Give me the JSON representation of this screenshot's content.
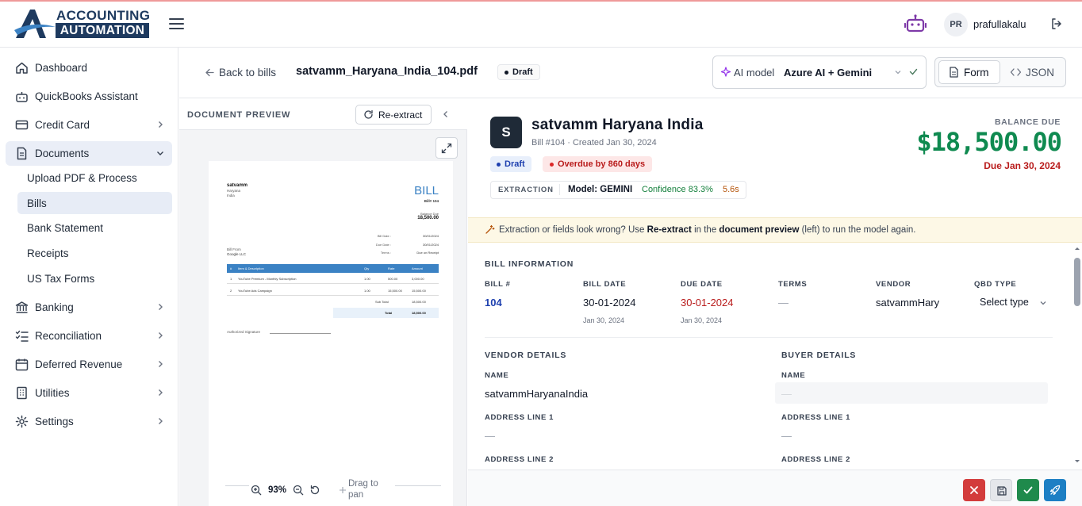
{
  "brand": {
    "line1": "ACCOUNTING",
    "line2": "AUTOMATION"
  },
  "user": {
    "initials": "PR",
    "name": "prafullakalu"
  },
  "sidebar": {
    "items": [
      {
        "label": "Dashboard",
        "icon": "home-icon"
      },
      {
        "label": "QuickBooks Assistant",
        "icon": "robot-icon"
      },
      {
        "label": "Credit Card",
        "icon": "credit-card-icon"
      },
      {
        "label": "Documents",
        "icon": "document-icon"
      },
      {
        "label": "Banking",
        "icon": "bank-icon"
      },
      {
        "label": "Reconciliation",
        "icon": "checklist-icon"
      },
      {
        "label": "Deferred Revenue",
        "icon": "calendar-icon"
      },
      {
        "label": "Utilities",
        "icon": "building-icon"
      },
      {
        "label": "Settings",
        "icon": "gear-icon"
      }
    ],
    "documents_sub": [
      "Upload PDF & Process",
      "Bills",
      "Bank Statement",
      "Receipts",
      "US Tax Forms"
    ]
  },
  "header": {
    "back_label": "Back to bills",
    "filename": "satvamm_Haryana_India_104.pdf",
    "status": "Draft",
    "ai_model_label": "AI model",
    "ai_model_value": "Azure AI + Gemini",
    "view_form": "Form",
    "view_json": "JSON"
  },
  "preview": {
    "title": "DOCUMENT PREVIEW",
    "reextract_label": "Re-extract",
    "zoom": "93%",
    "drag_hint": "Drag to pan",
    "doc": {
      "vendor_name": "satvamm",
      "vendor_lines": [
        "Haryana",
        "India"
      ],
      "heading": "BILL",
      "bill_no": "Bill# 104",
      "balance_label": "Balance Due",
      "balance": "18,500.00",
      "meta": [
        {
          "label": "Bill Date :",
          "value": "30/01/2024"
        },
        {
          "label": "Due Date :",
          "value": "30/01/2024"
        },
        {
          "label": "Terms :",
          "value": "Due on Receipt"
        }
      ],
      "bill_from_label": "Bill From",
      "bill_from": "Google LLC",
      "columns": [
        "#",
        "Item & Description",
        "Qty",
        "Rate",
        "Amount"
      ],
      "rows": [
        [
          "1",
          "YouTube Premium - Monthly Subscription",
          "1.00",
          "500.00",
          "3,000.00"
        ],
        [
          "2",
          "YouTube Ads Campaign",
          "1.00",
          "15,500.00",
          "15,500.00"
        ]
      ],
      "subtotal_label": "Sub Total",
      "subtotal": "18,500.00",
      "total_label": "Total",
      "total": "18,500.00",
      "signature_label": "Authorized Signature"
    }
  },
  "bill": {
    "avatar": "S",
    "vendor_title": "satvamm Haryana India",
    "subtitle": "Bill #104 · Created Jan 30, 2024",
    "status_chip": "Draft",
    "overdue_chip": "Overdue by 860 days",
    "extraction": {
      "label": "EXTRACTION",
      "model": "Model: GEMINI",
      "confidence": "Confidence 83.3%",
      "time": "5.6s"
    },
    "balance_label": "BALANCE DUE",
    "balance": "$18,500.00",
    "due_text": "Due Jan 30, 2024"
  },
  "notice": {
    "prefix": "Extraction or fields look wrong? Use ",
    "strong1": "Re-extract",
    "mid": " in the ",
    "strong2": "document preview",
    "suffix": " (left) to run the model again."
  },
  "bill_info": {
    "section": "BILL INFORMATION",
    "bill_no_label": "BILL #",
    "bill_no": "104",
    "bill_date_label": "BILL DATE",
    "bill_date": "30-01-2024",
    "bill_date_sub": "Jan 30, 2024",
    "due_date_label": "DUE DATE",
    "due_date": "30-01-2024",
    "due_date_sub": "Jan 30, 2024",
    "terms_label": "TERMS",
    "terms": "—",
    "vendor_label": "VENDOR",
    "vendor": "satvammHary",
    "qbd_label": "QBD TYPE",
    "qbd": "Select type"
  },
  "vendor_details": {
    "section": "VENDOR DETAILS",
    "name_label": "NAME",
    "name": "satvammHaryanaIndia",
    "addr1_label": "ADDRESS LINE 1",
    "addr1": "—",
    "addr2_label": "ADDRESS LINE 2"
  },
  "buyer_details": {
    "section": "BUYER DETAILS",
    "name_label": "NAME",
    "name": "—",
    "addr1_label": "ADDRESS LINE 1",
    "addr1": "—",
    "addr2_label": "ADDRESS LINE 2"
  },
  "colors": {
    "brand": "#1e3a5f",
    "balance": "#0f8a50",
    "danger": "#b91c1c",
    "accent_blue": "#1e40af"
  }
}
